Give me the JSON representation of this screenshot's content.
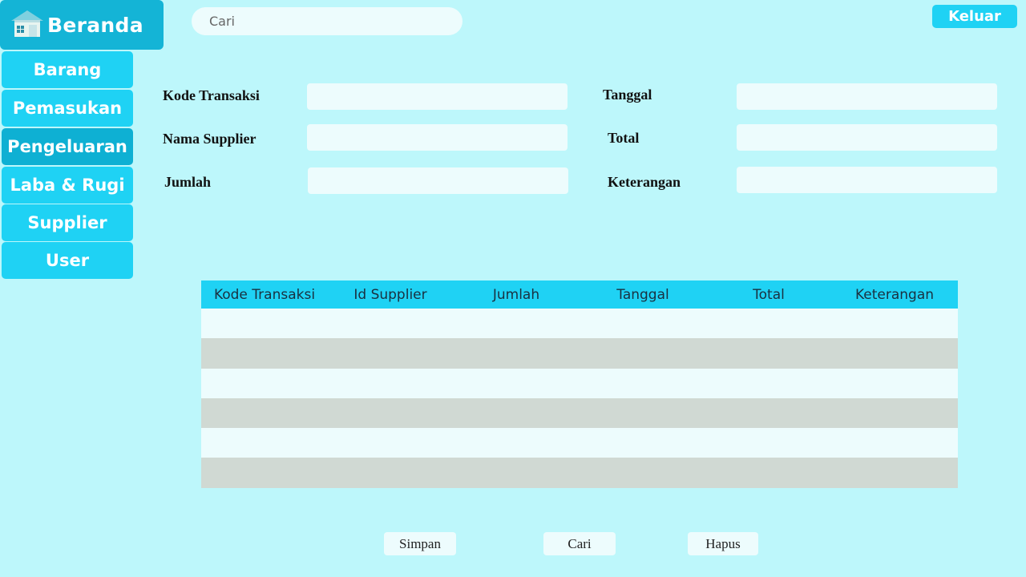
{
  "brand": {
    "label": "Beranda",
    "icon": "house-icon"
  },
  "search": {
    "placeholder": "Cari"
  },
  "logout_label": "Keluar",
  "nav": [
    {
      "label": "Barang",
      "active": false
    },
    {
      "label": "Pemasukan",
      "active": false
    },
    {
      "label": "Pengeluaran",
      "active": true
    },
    {
      "label": "Laba & Rugi",
      "active": false
    },
    {
      "label": "Supplier",
      "active": false
    },
    {
      "label": "User",
      "active": false
    }
  ],
  "form": {
    "kode_transaksi": {
      "label": "Kode Transaksi",
      "value": ""
    },
    "tanggal": {
      "label": "Tanggal",
      "value": ""
    },
    "nama_supplier": {
      "label": "Nama Supplier",
      "value": ""
    },
    "total": {
      "label": "Total",
      "value": ""
    },
    "jumlah": {
      "label": "Jumlah",
      "value": ""
    },
    "keterangan": {
      "label": "Keterangan",
      "value": ""
    }
  },
  "table": {
    "columns": [
      "Kode Transaksi",
      "Id Supplier",
      "Jumlah",
      "Tanggal",
      "Total",
      "Keterangan"
    ],
    "rows": [
      [],
      [],
      [],
      [],
      [],
      []
    ]
  },
  "buttons": {
    "save": "Simpan",
    "find": "Cari",
    "delete": "Hapus"
  },
  "colors": {
    "background": "#bdf7fb",
    "accent": "#1fd2f4",
    "active_nav": "#0eb0d3",
    "input_bg": "#edfcfd",
    "row_alt": "#d0d9d3"
  }
}
